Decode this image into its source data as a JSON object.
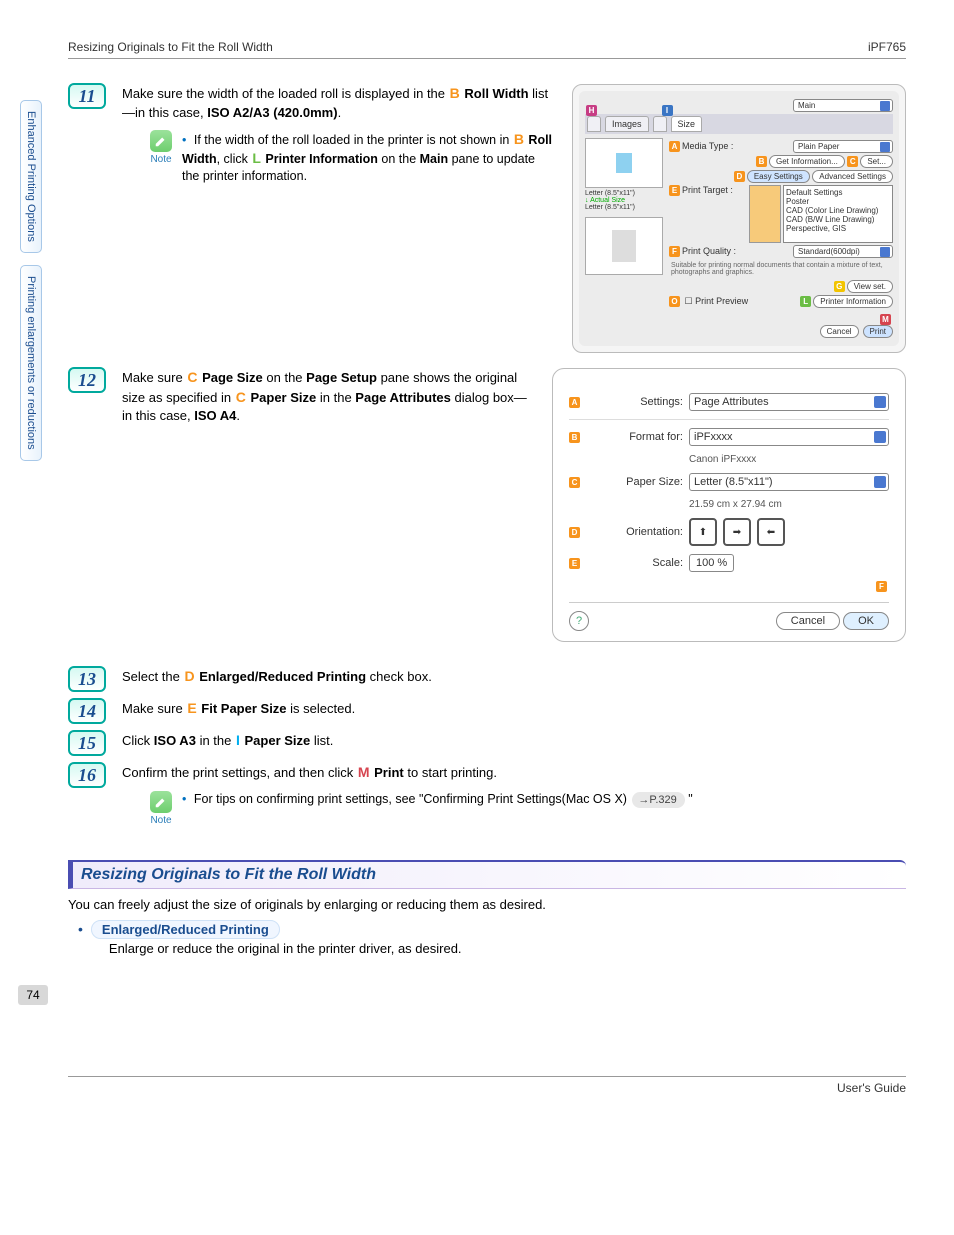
{
  "header": {
    "left": "Resizing Originals to Fit the Roll Width",
    "right": "iPF765"
  },
  "sideTabs": {
    "t1": "Enhanced Printing Options",
    "t2": "Printing enlargements or reductions"
  },
  "steps": {
    "s11": {
      "num": "11",
      "p1a": "Make sure the width of the loaded roll is displayed in the ",
      "p1b_letter": "B",
      "p1b_bold": "Roll Width",
      "p1c": " list—in this case, ",
      "p1d_bold": "ISO A2/A3 (420.0mm)",
      "p1e": "."
    },
    "s11note": {
      "bullet": "•",
      "a": "If the width of the roll loaded in the printer is not shown in ",
      "b_letter": "B",
      "b_bold": "Roll Width",
      "c": ", click ",
      "d_letter": "L",
      "d_bold": "Printer Information",
      "e": " on the ",
      "f_bold": "Main",
      "g": " pane to update the printer information.",
      "noteLabel": "Note"
    },
    "s12": {
      "num": "12",
      "a": "Make sure ",
      "b_letter": "C",
      "b_bold": "Page Size",
      "c": " on the ",
      "d_bold": "Page Setup",
      "e": " pane shows the original size as specified in ",
      "f_letter": "C",
      "f_bold": "Paper Size",
      "g": " in the ",
      "h_bold": "Page Attributes",
      "i": " dialog box—in this case, ",
      "j_bold": "ISO A4",
      "k": "."
    },
    "s13": {
      "num": "13",
      "a": "Select the ",
      "b_letter": "D",
      "b_bold": "Enlarged/Reduced Printing",
      "c": " check box."
    },
    "s14": {
      "num": "14",
      "a": "Make sure ",
      "b_letter": "E",
      "b_bold": "Fit Paper Size",
      "c": " is selected."
    },
    "s15": {
      "num": "15",
      "a": "Click ",
      "b_bold": "ISO A3",
      "c": " in the ",
      "d_letter": "I",
      "d_bold": "Paper Size",
      "e": " list."
    },
    "s16": {
      "num": "16",
      "a": "Confirm the print settings, and then click ",
      "b_letter": "M",
      "b_bold": "Print",
      "c": " to start printing."
    },
    "s16note": {
      "bullet": "•",
      "a": "For tips on confirming print settings, see \"Confirming Print Settings(Mac OS X) ",
      "pill": "→P.329",
      "b": " \"",
      "noteLabel": "Note"
    }
  },
  "section": {
    "title": "Resizing Originals to Fit the Roll Width",
    "intro": "You can freely adjust the size of originals by enlarging or reducing them as desired.",
    "bullet": "•",
    "subHead": "Enlarged/Reduced Printing",
    "subBody": "Enlarge or reduce the original in the printer driver, as desired."
  },
  "shot1": {
    "tabMain": "Main",
    "tabImages": "Images",
    "tabSize": "Size",
    "mediaType": "Media Type :",
    "mediaTypeVal": "Plain Paper",
    "getInfo": "Get Information...",
    "set": "Set...",
    "easy": "Easy Settings",
    "adv": "Advanced Settings",
    "printTarget": "Print Target :",
    "list": [
      "Default Settings",
      "Poster",
      "CAD (Color Line Drawing)",
      "CAD (B/W Line Drawing)",
      "Perspective, GIS"
    ],
    "printQuality": "Print Quality :",
    "printQualityVal": "Standard(600dpi)",
    "desc": "Suitable for printing normal documents that contain a mixture of text, photographs and graphics.",
    "viewSet": "View set.",
    "printPreview": "Print Preview",
    "printerInfo": "Printer Information",
    "cancel": "Cancel",
    "print": "Print",
    "thumb1": "Letter (8.5\"x11\")",
    "thumb2": "Actual Size",
    "thumb3": "Letter (8.5\"x11\")"
  },
  "shot2": {
    "settings": "Settings:",
    "settingsVal": "Page Attributes",
    "formatFor": "Format for:",
    "formatForVal": "iPFxxxx",
    "formatForSub": "Canon iPFxxxx",
    "paperSize": "Paper Size:",
    "paperSizeVal": "Letter (8.5\"x11\")",
    "paperSizeSub": "21.59 cm x 27.94 cm",
    "orientation": "Orientation:",
    "scale": "Scale:",
    "scaleVal": "100 %",
    "cancel": "Cancel",
    "ok": "OK",
    "tagA": "A",
    "tagB": "B",
    "tagC": "C",
    "tagD": "D",
    "tagE": "E",
    "tagF": "F"
  },
  "pageNum": "74",
  "footer": "User's Guide"
}
